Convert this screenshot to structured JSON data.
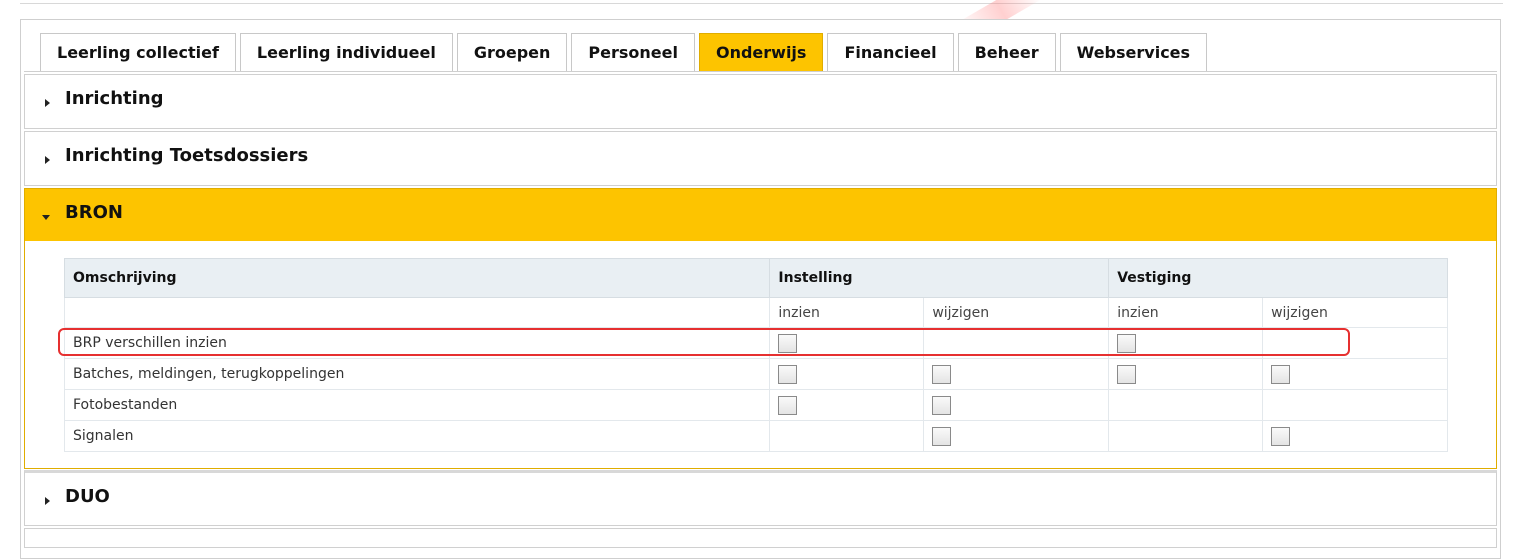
{
  "tabs": [
    {
      "label": "Leerling collectief",
      "active": false
    },
    {
      "label": "Leerling individueel",
      "active": false
    },
    {
      "label": "Groepen",
      "active": false
    },
    {
      "label": "Personeel",
      "active": false
    },
    {
      "label": "Onderwijs",
      "active": true
    },
    {
      "label": "Financieel",
      "active": false
    },
    {
      "label": "Beheer",
      "active": false
    },
    {
      "label": "Webservices",
      "active": false
    }
  ],
  "sections": {
    "inrichting": {
      "title": "Inrichting",
      "expanded": false
    },
    "toetsdossiers": {
      "title": "Inrichting Toetsdossiers",
      "expanded": false
    },
    "bron": {
      "title": "BRON",
      "expanded": true
    },
    "duo": {
      "title": "DUO",
      "expanded": false
    }
  },
  "table": {
    "header": {
      "omschrijving": "Omschrijving",
      "instelling": "Instelling",
      "vestiging": "Vestiging"
    },
    "subheader": {
      "inst_inzien": "inzien",
      "inst_wijzigen": "wijzigen",
      "vest_inzien": "inzien",
      "vest_wijzigen": "wijzigen"
    },
    "rows": [
      {
        "label": "BRP verschillen inzien",
        "cells": [
          true,
          false,
          true,
          false
        ],
        "highlighted": true
      },
      {
        "label": "Batches, meldingen, terugkoppelingen",
        "cells": [
          true,
          true,
          true,
          true
        ],
        "highlighted": false
      },
      {
        "label": "Fotobestanden",
        "cells": [
          true,
          true,
          false,
          false
        ],
        "highlighted": false
      },
      {
        "label": "Signalen",
        "cells": [
          false,
          true,
          false,
          true
        ],
        "highlighted": false
      }
    ]
  },
  "colors": {
    "accent": "#fdc400",
    "highlight": "#e63030"
  }
}
